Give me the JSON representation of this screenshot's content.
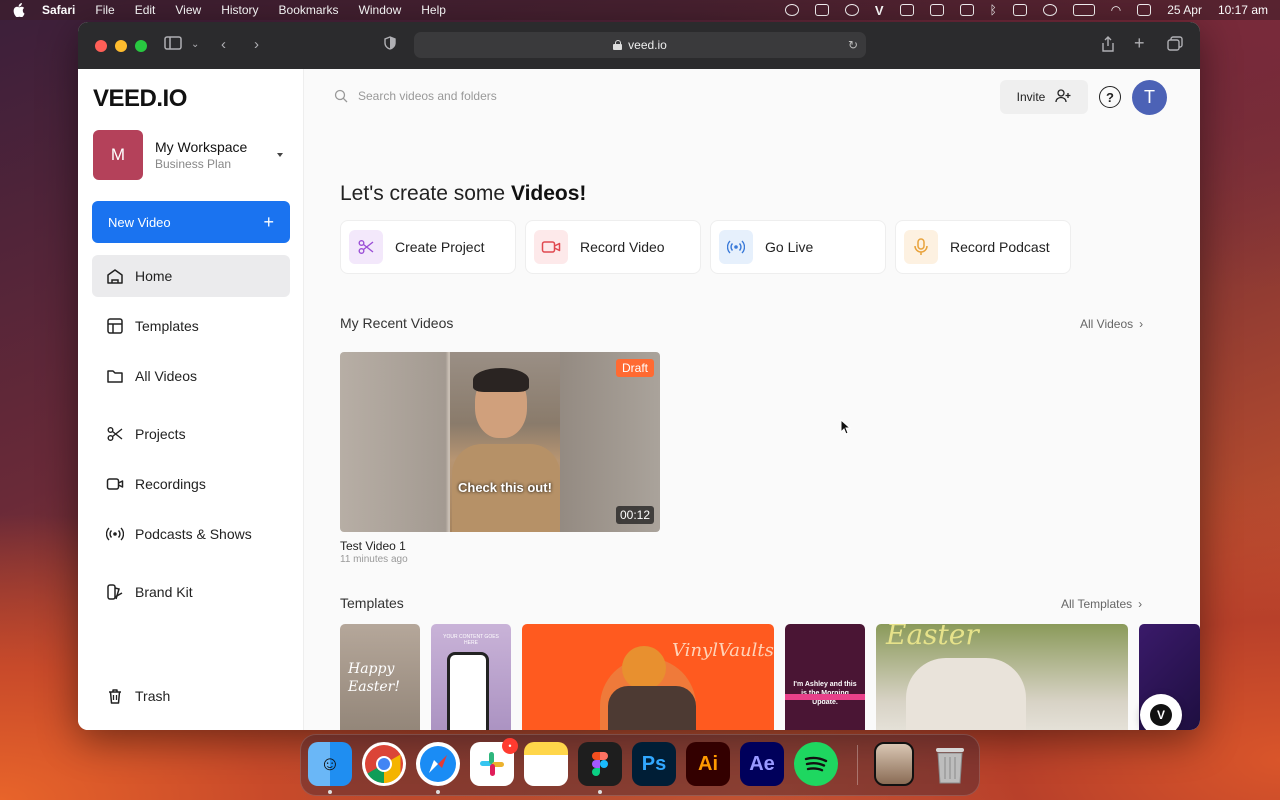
{
  "menubar": {
    "app": "Safari",
    "items": [
      "File",
      "Edit",
      "View",
      "History",
      "Bookmarks",
      "Window",
      "Help"
    ],
    "date": "25 Apr",
    "time": "10:17 am"
  },
  "browser": {
    "url": "veed.io"
  },
  "sidebar": {
    "logo": "VEED.IO",
    "workspace": {
      "initial": "M",
      "name": "My Workspace",
      "plan": "Business Plan"
    },
    "new_video": "New Video",
    "nav": [
      {
        "label": "Home",
        "icon": "home-icon",
        "active": true
      },
      {
        "label": "Templates",
        "icon": "templates-icon"
      },
      {
        "label": "All Videos",
        "icon": "folder-icon"
      },
      {
        "label": "Projects",
        "icon": "scissors-icon"
      },
      {
        "label": "Recordings",
        "icon": "camera-icon"
      },
      {
        "label": "Podcasts & Shows",
        "icon": "broadcast-icon"
      },
      {
        "label": "Brand Kit",
        "icon": "brand-kit-icon"
      },
      {
        "label": "Trash",
        "icon": "trash-icon"
      }
    ]
  },
  "header": {
    "search_placeholder": "Search videos and folders",
    "invite": "Invite",
    "help": "?",
    "avatar_initial": "T"
  },
  "main": {
    "headline_prefix": "Let's create some ",
    "headline_bold": "Videos!",
    "quick_actions": [
      {
        "label": "Create Project",
        "icon": "scissors-icon",
        "bg": "#f3e8fb",
        "color": "#9b4fd6"
      },
      {
        "label": "Record Video",
        "icon": "video-icon",
        "bg": "#fde9ea",
        "color": "#e0484f"
      },
      {
        "label": "Go Live",
        "icon": "broadcast-icon",
        "bg": "#e6f0fc",
        "color": "#3a7ad9"
      },
      {
        "label": "Record Podcast",
        "icon": "mic-icon",
        "bg": "#fdf1e1",
        "color": "#e8a23a"
      }
    ],
    "recent_title": "My Recent Videos",
    "recent_link": "All Videos",
    "video": {
      "status": "Draft",
      "caption": "Check this out!",
      "duration": "00:12",
      "title": "Test Video 1",
      "time": "11 minutes ago"
    },
    "templates_title": "Templates",
    "templates_link": "All Templates",
    "templates": [
      {
        "text": "Happy Easter!"
      },
      {
        "text": "YOUR CONTENT GOES HERE"
      },
      {
        "text": "VinylVaults"
      },
      {
        "text": "I'm Ashley and this is the Morning Update."
      },
      {
        "text": "Easter"
      }
    ]
  },
  "dock": {
    "apps": [
      "Finder",
      "Chrome",
      "Safari",
      "Slack",
      "Notes",
      "Figma",
      "Photoshop",
      "Illustrator",
      "After Effects",
      "Spotify",
      "Preview",
      "Trash"
    ],
    "slack_badge": "•"
  }
}
